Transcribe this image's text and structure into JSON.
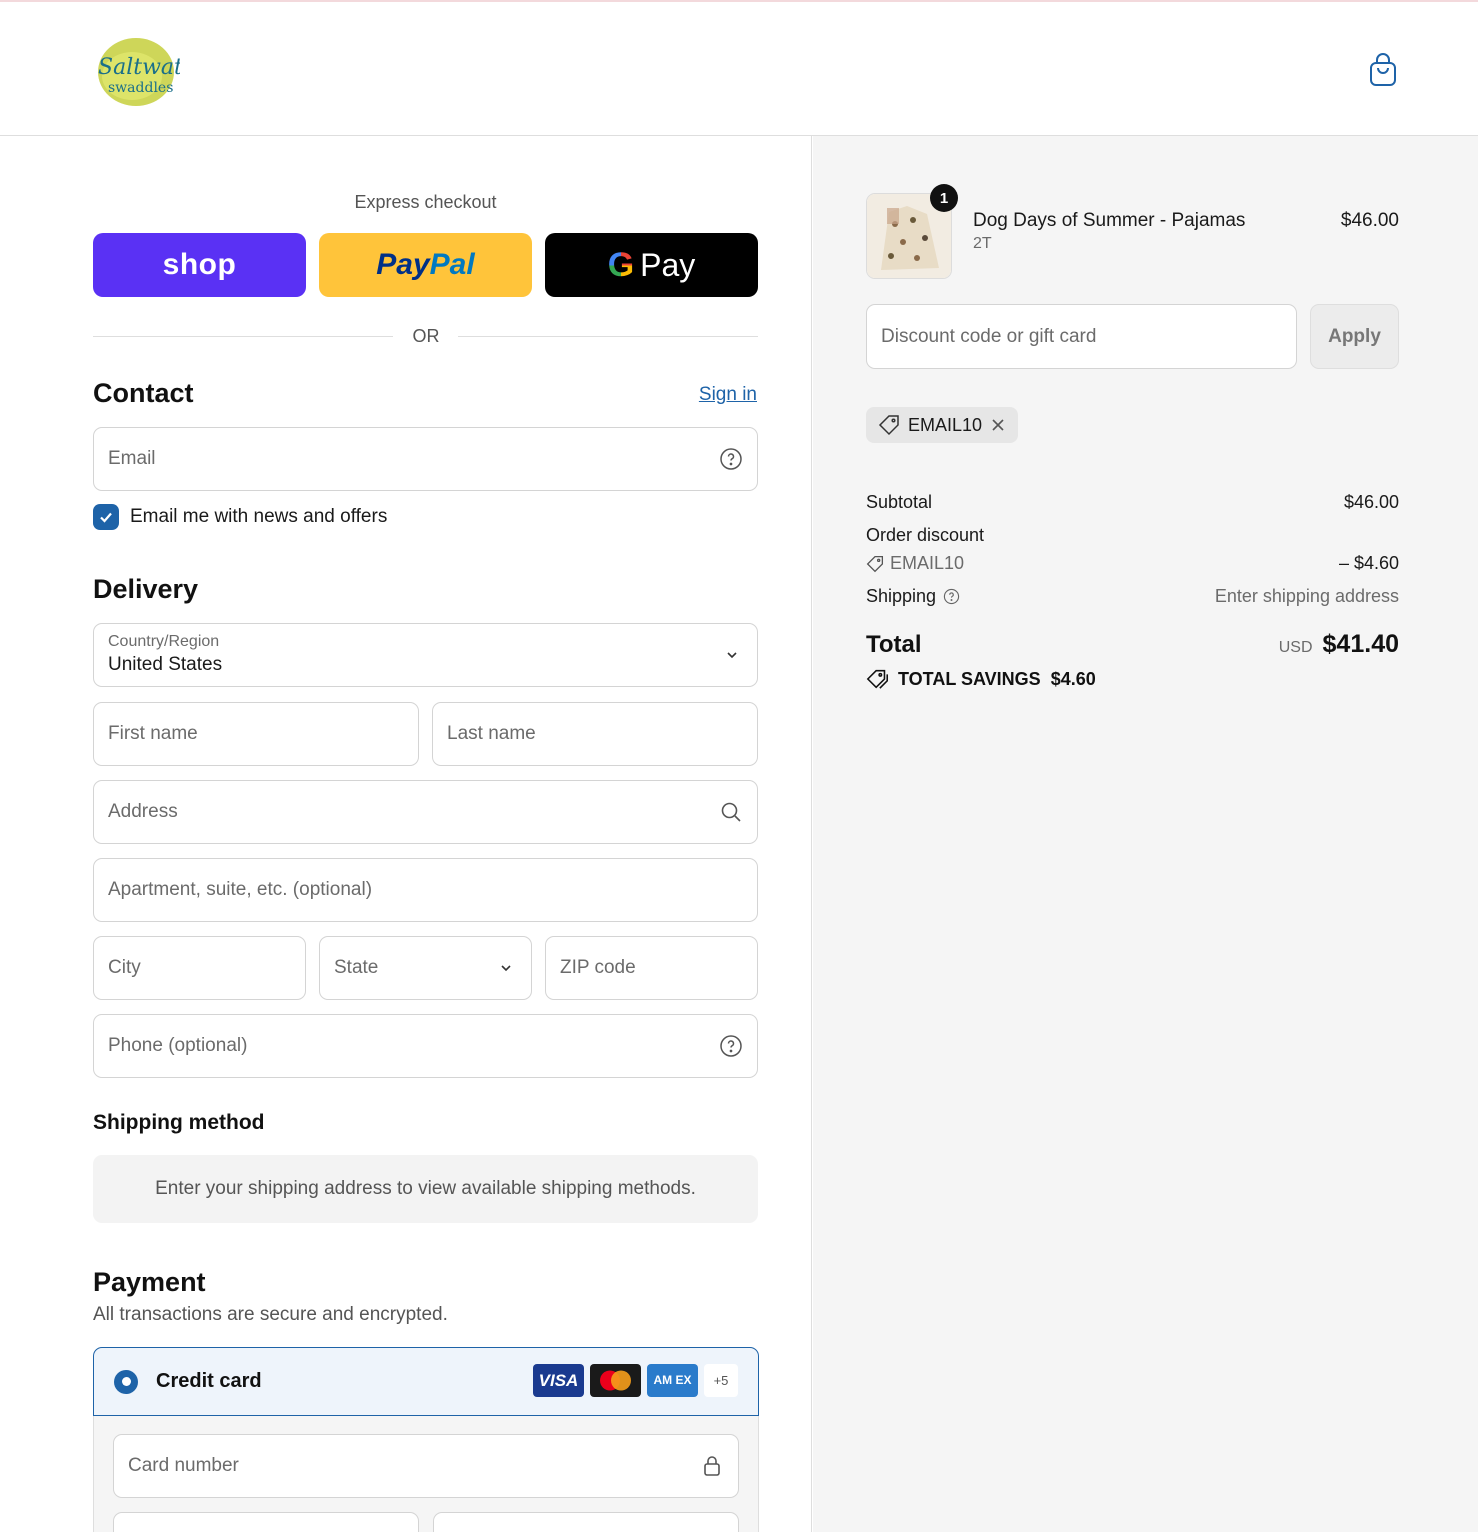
{
  "brand": {
    "logo_text_line1": "Saltwater",
    "logo_text_line2": "swaddles"
  },
  "colors": {
    "accent": "#1e63a8",
    "shop_pay": "#5a31f4",
    "paypal": "#ffc43a",
    "gpay": "#000000"
  },
  "header": {
    "cart_icon": "shopping-bag-icon"
  },
  "express": {
    "title": "Express checkout",
    "shop_label": "shop",
    "paypal_label_1": "Pay",
    "paypal_label_2": "Pal",
    "gpay_g": "G",
    "gpay_label": "Pay",
    "or": "OR"
  },
  "contact": {
    "heading": "Contact",
    "sign_in": "Sign in",
    "email_placeholder": "Email",
    "newsletter_label": "Email me with news and offers",
    "newsletter_checked": true
  },
  "delivery": {
    "heading": "Delivery",
    "country_label": "Country/Region",
    "country_value": "United States",
    "first_name": "First name",
    "last_name": "Last name",
    "address": "Address",
    "apartment": "Apartment, suite, etc. (optional)",
    "city": "City",
    "state": "State",
    "zip": "ZIP code",
    "phone": "Phone (optional)"
  },
  "shipping_method": {
    "heading": "Shipping method",
    "info": "Enter your shipping address to view available shipping methods."
  },
  "payment": {
    "heading": "Payment",
    "subtitle": "All transactions are secure and encrypted.",
    "credit_card_label": "Credit card",
    "card_brands": [
      "VISA",
      "Mastercard",
      "AM EX"
    ],
    "more_cards": "+5",
    "card_number": "Card number"
  },
  "summary": {
    "item": {
      "quantity": "1",
      "name": "Dog Days of Summer - Pajamas",
      "variant": "2T",
      "price": "$46.00"
    },
    "discount_placeholder": "Discount code or gift card",
    "apply_label": "Apply",
    "applied_code": "EMAIL10",
    "subtotal_label": "Subtotal",
    "subtotal_value": "$46.00",
    "order_discount_label": "Order discount",
    "order_discount_code": "EMAIL10",
    "order_discount_value": "– $4.60",
    "shipping_label": "Shipping",
    "shipping_value": "Enter shipping address",
    "total_label": "Total",
    "total_currency": "USD",
    "total_value": "$41.40",
    "savings_label": "TOTAL SAVINGS",
    "savings_value": "$4.60"
  }
}
